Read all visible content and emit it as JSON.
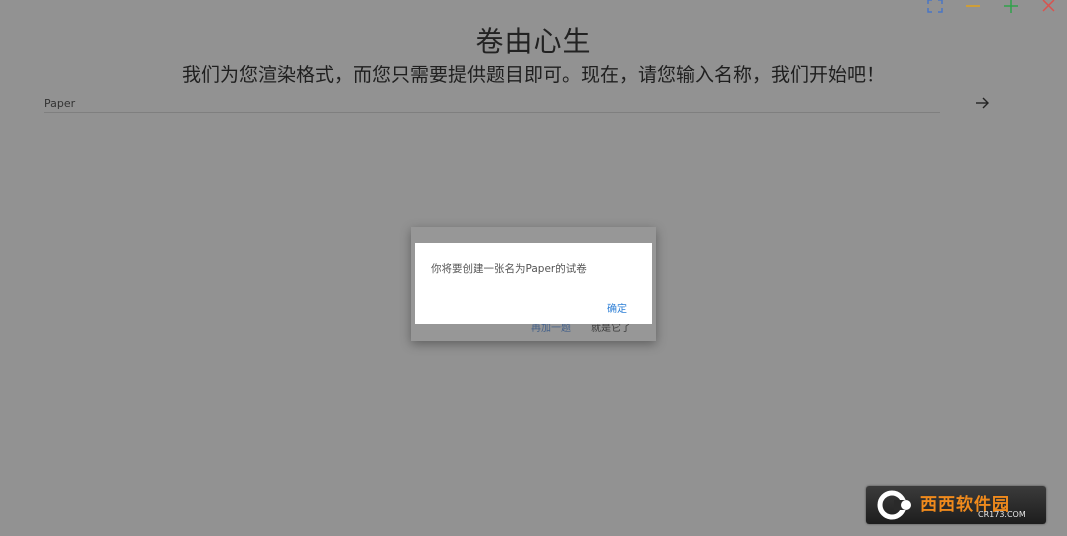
{
  "app": {
    "title": "卷由心生",
    "subtitle": "我们为您渲染格式，而您只需要提供题目即可。现在，请您输入名称，我们开始吧！"
  },
  "name_input": {
    "value": "Paper"
  },
  "window_controls": {
    "icons": [
      "fullscreen-icon",
      "minimize-icon",
      "maximize-icon",
      "close-icon"
    ],
    "colors": {
      "fullscreen": "#4a76c4",
      "minimize": "#e3a21a",
      "maximize": "#2fa24a",
      "close": "#d9534f"
    }
  },
  "base_dialog": {
    "primary_label": "再加一题",
    "secondary_label": "就是它了"
  },
  "alert": {
    "message": "你将要创建一张名为Paper的试卷",
    "confirm_label": "确定",
    "confirm_color": "#2d7fd6"
  },
  "watermark": {
    "brand": "西西软件园",
    "url": "CR173.COM"
  }
}
